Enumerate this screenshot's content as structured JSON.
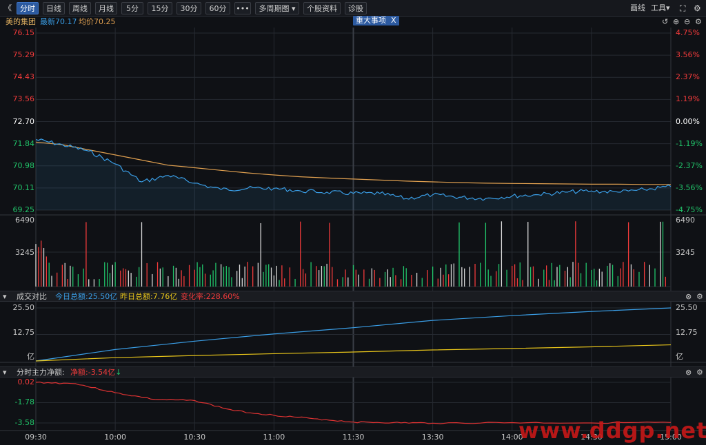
{
  "toolbar": {
    "back": "《",
    "tabs": [
      "分时",
      "日线",
      "周线",
      "月线",
      "5分",
      "15分",
      "30分",
      "60分"
    ],
    "more": "•••",
    "multi_period": "多周期图",
    "stock_info": "个股资料",
    "diagnosis": "诊股",
    "draw": "画线",
    "tools": "工具"
  },
  "infobar": {
    "stock_name": "美的集团",
    "latest_label": "最新",
    "latest_value": "70.17",
    "avg_label": "均价",
    "avg_value": "70.25",
    "event_badge": "重大事项",
    "event_close": "X"
  },
  "price_axis": {
    "left": [
      "76.15",
      "75.29",
      "74.43",
      "73.56",
      "72.70",
      "71.84",
      "70.98",
      "70.11",
      "69.25"
    ],
    "right": [
      "4.75%",
      "3.56%",
      "2.37%",
      "1.19%",
      "0.00%",
      "-1.19%",
      "-2.37%",
      "-3.56%",
      "-4.75%"
    ]
  },
  "volume_axis": {
    "top": "6490",
    "mid": "3245"
  },
  "turnover_panel": {
    "title": "成交对比",
    "today_label": "今日总额:",
    "today_value": "25.50亿",
    "yesterday_label": "昨日总额:",
    "yesterday_value": "7.76亿",
    "change_label": "变化率:",
    "change_value": "228.60%",
    "axis": [
      "25.50",
      "12.75",
      "亿"
    ]
  },
  "capital_panel": {
    "title": "分时主力净额:",
    "net_label": "净额:",
    "net_value": "-3.54亿",
    "axis": [
      "0.02",
      "-1.78",
      "-3.58"
    ]
  },
  "time_axis": [
    "09:30",
    "10:00",
    "10:30",
    "11:00",
    "11:30",
    "13:30",
    "14:00",
    "14:30",
    "15:00"
  ],
  "watermark": "www.ddgp.net",
  "colors": {
    "up": "#f23b3b",
    "down": "#21c56a",
    "price_line": "#3a9ee6",
    "avg_line": "#e0a050",
    "today_line": "#3a9ee6",
    "yesterday_line": "#e8c51a",
    "capital_line": "#e03333",
    "grid": "#262a31"
  },
  "chart_data": [
    {
      "type": "line",
      "x": [
        "09:30",
        "09:40",
        "09:50",
        "10:00",
        "10:10",
        "10:20",
        "10:30",
        "10:40",
        "10:50",
        "11:00",
        "11:10",
        "11:20",
        "11:30",
        "13:10",
        "13:20",
        "13:30",
        "13:40",
        "13:50",
        "14:00",
        "14:10",
        "14:20",
        "14:30",
        "14:40",
        "14:50",
        "15:00"
      ],
      "series": [
        {
          "name": "最新",
          "values": [
            72.0,
            71.8,
            71.55,
            71.05,
            70.35,
            70.6,
            70.3,
            70.05,
            70.1,
            70.1,
            70.0,
            69.95,
            69.9,
            69.9,
            69.7,
            69.85,
            69.75,
            69.7,
            69.8,
            69.85,
            69.95,
            70.0,
            69.95,
            70.05,
            70.17
          ]
        },
        {
          "name": "均价",
          "values": [
            71.9,
            71.8,
            71.6,
            71.4,
            71.2,
            71.0,
            70.9,
            70.8,
            70.7,
            70.62,
            70.55,
            70.5,
            70.46,
            70.42,
            70.38,
            70.35,
            70.32,
            70.3,
            70.29,
            70.28,
            70.27,
            70.26,
            70.26,
            70.25,
            70.25
          ]
        }
      ],
      "ylim": [
        69.25,
        76.15
      ]
    },
    {
      "type": "line",
      "x": [
        "09:30",
        "10:00",
        "10:30",
        "11:00",
        "11:30",
        "13:30",
        "14:00",
        "14:30",
        "15:00"
      ],
      "series": [
        {
          "name": "今日总额",
          "values": [
            0,
            5.5,
            9.5,
            13.0,
            16.0,
            19.5,
            21.8,
            23.8,
            25.5
          ]
        },
        {
          "name": "昨日总额",
          "values": [
            0,
            1.6,
            2.6,
            3.5,
            4.3,
            5.3,
            6.0,
            6.8,
            7.76
          ]
        }
      ],
      "ylim": [
        0,
        25.5
      ]
    },
    {
      "type": "line",
      "x": [
        "09:30",
        "09:45",
        "10:00",
        "10:15",
        "10:30",
        "10:45",
        "11:00",
        "11:15",
        "11:30",
        "13:15",
        "13:30",
        "14:00",
        "14:30",
        "15:00"
      ],
      "series": [
        {
          "name": "净额",
          "values": [
            0.02,
            -0.1,
            -0.9,
            -1.5,
            -1.6,
            -2.5,
            -2.9,
            -3.2,
            -3.5,
            -3.55,
            -3.6,
            -3.55,
            -3.58,
            -3.54
          ]
        }
      ],
      "ylim": [
        -3.58,
        0.02
      ]
    }
  ]
}
